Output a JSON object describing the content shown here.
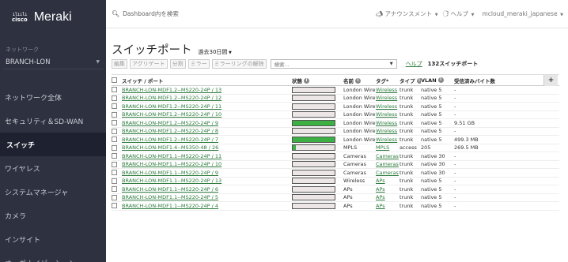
{
  "sidebar": {
    "logo_cisco_bars": "ahah",
    "logo_cisco_word": "cisco",
    "logo_meraki": "Meraki",
    "network_label": "ネットワーク",
    "network_value": "BRANCH-LON",
    "nav": [
      {
        "label": "ネットワーク全体",
        "active": false
      },
      {
        "label": "セキュリティ＆SD-WAN",
        "active": false
      },
      {
        "label": "スイッチ",
        "active": true
      },
      {
        "label": "ワイヤレス",
        "active": false
      },
      {
        "label": "システムマネージャ",
        "active": false
      },
      {
        "label": "カメラ",
        "active": false
      },
      {
        "label": "インサイト",
        "active": false
      },
      {
        "label": "オーガナイゼーション",
        "active": false
      }
    ]
  },
  "topbar": {
    "search_placeholder": "Dashboard内を検索",
    "announcements": "アナウンスメント",
    "help": "ヘルプ",
    "user": "mcloud_meraki_japanese"
  },
  "main": {
    "title": "スイッチポート",
    "timespan": "過去30日間",
    "toolbar": {
      "edit": "編集",
      "aggregate": "アグリゲート",
      "split": "分割",
      "mirror": "ミラー",
      "unmirror": "ミラーリングの解除",
      "filter_placeholder": "検索...",
      "help_link": "ヘルプ",
      "count": "132スイッチポート"
    },
    "columns": {
      "port": "スイッチ / ポート",
      "status": "状態",
      "name": "名前",
      "tags": "タグ*",
      "type": "タイプ",
      "vlan": "VLAN",
      "received": "受信済みバイト数"
    },
    "add_button": "+"
  },
  "rows": [
    {
      "port": "BRANCH-LON-MDF1.2--MS220-24P / 13",
      "status": 0,
      "name": "London Wireless",
      "tag": "Wireless",
      "type": "trunk",
      "vlan": "native 5",
      "rx": "-"
    },
    {
      "port": "BRANCH-LON-MDF1.2--MS220-24P / 12",
      "status": 0,
      "name": "London Wireless",
      "tag": "Wireless",
      "type": "trunk",
      "vlan": "native 5",
      "rx": "-"
    },
    {
      "port": "BRANCH-LON-MDF1.2--MS220-24P / 11",
      "status": 0,
      "name": "London Wireless",
      "tag": "Wireless",
      "type": "trunk",
      "vlan": "native 5",
      "rx": "-"
    },
    {
      "port": "BRANCH-LON-MDF1.2--MS220-24P / 10",
      "status": 0,
      "name": "London Wireless",
      "tag": "Wireless",
      "type": "trunk",
      "vlan": "native 5",
      "rx": "-"
    },
    {
      "port": "BRANCH-LON-MDF1.2--MS220-24P / 9",
      "status": 1,
      "name": "London Wireless",
      "tag": "Wireless",
      "type": "trunk",
      "vlan": "native 5",
      "rx": "9.51 GB"
    },
    {
      "port": "BRANCH-LON-MDF1.2--MS220-24P / 8",
      "status": 0,
      "name": "London Wireless",
      "tag": "Wireless",
      "type": "trunk",
      "vlan": "native 5",
      "rx": "-"
    },
    {
      "port": "BRANCH-LON-MDF1.2--MS220-24P / 7",
      "status": 1,
      "name": "London Wireless",
      "tag": "Wireless",
      "type": "trunk",
      "vlan": "native 5",
      "rx": "499.3 MB"
    },
    {
      "port": "BRANCH-LON-MDF1.4--MS350-48 / 26",
      "status": 0.08,
      "name": "MPLS",
      "tag": "MPLS",
      "type": "access",
      "vlan": "205",
      "rx": "269.5 MB"
    },
    {
      "port": "BRANCH-LON-MDF1.1--MS220-24P / 11",
      "status": 0,
      "name": "Cameras",
      "tag": "Cameras",
      "type": "trunk",
      "vlan": "native 30",
      "rx": "-"
    },
    {
      "port": "BRANCH-LON-MDF1.1--MS220-24P / 10",
      "status": 0,
      "name": "Cameras",
      "tag": "Cameras",
      "type": "trunk",
      "vlan": "native 30",
      "rx": "-"
    },
    {
      "port": "BRANCH-LON-MDF1.1--MS220-24P / 9",
      "status": 0,
      "name": "Cameras",
      "tag": "Cameras",
      "type": "trunk",
      "vlan": "native 30",
      "rx": "-"
    },
    {
      "port": "BRANCH-LON-MDF1.1--MS220-24P / 13",
      "status": 0,
      "name": "Wireless",
      "tag": "APs",
      "type": "trunk",
      "vlan": "native 5",
      "rx": "-"
    },
    {
      "port": "BRANCH-LON-MDF1.1--MS220-24P / 6",
      "status": 0,
      "name": "APs",
      "tag": "APs",
      "type": "trunk",
      "vlan": "native 5",
      "rx": "-"
    },
    {
      "port": "BRANCH-LON-MDF1.1--MS220-24P / 5",
      "status": 0,
      "name": "APs",
      "tag": "APs",
      "type": "trunk",
      "vlan": "native 5",
      "rx": "-"
    },
    {
      "port": "BRANCH-LON-MDF1.1--MS220-24P / 4",
      "status": 0,
      "name": "APs",
      "tag": "APs",
      "type": "trunk",
      "vlan": "native 5",
      "rx": "-"
    }
  ]
}
